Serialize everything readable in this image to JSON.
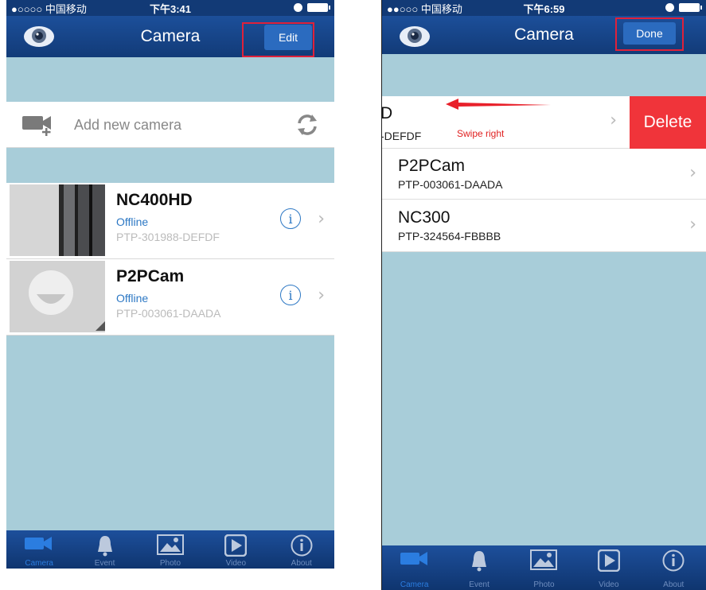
{
  "left": {
    "status": {
      "carrier": "●○○○○ 中国移动",
      "time": "下午3:41"
    },
    "nav": {
      "title": "Camera",
      "edit_label": "Edit"
    },
    "add_camera_label": "Add new camera",
    "cameras": [
      {
        "name": "NC400HD",
        "status": "Offline",
        "id": "PTP-301988-DEFDF"
      },
      {
        "name": "P2PCam",
        "status": "Offline",
        "id": "PTP-003061-DAADA"
      }
    ],
    "tabs": [
      {
        "label": "Camera",
        "icon": "video-camera-icon"
      },
      {
        "label": "Event",
        "icon": "bell-icon"
      },
      {
        "label": "Photo",
        "icon": "photo-icon"
      },
      {
        "label": "Video",
        "icon": "play-icon"
      },
      {
        "label": "About",
        "icon": "info-icon"
      }
    ]
  },
  "right": {
    "status": {
      "carrier": "●●○○○ 中国移动",
      "time": "下午6:59"
    },
    "nav": {
      "title": "Camera",
      "done_label": "Done"
    },
    "swiped_row": {
      "name_fragment": "D",
      "id_fragment": "-DEFDF",
      "annotation": "Swipe right",
      "delete_label": "Delete"
    },
    "cameras": [
      {
        "name": "P2PCam",
        "id": "PTP-003061-DAADA"
      },
      {
        "name": "NC300",
        "id": "PTP-324564-FBBBB"
      }
    ],
    "tabs": [
      {
        "label": "Camera"
      },
      {
        "label": "Event"
      },
      {
        "label": "Photo"
      },
      {
        "label": "Video"
      },
      {
        "label": "About"
      }
    ]
  },
  "colors": {
    "nav_blue": "#123b78",
    "content_bg": "#a8cdd9",
    "accent_blue": "#2d78c4",
    "delete_red": "#f0343a",
    "highlight_red": "#e0213a"
  }
}
